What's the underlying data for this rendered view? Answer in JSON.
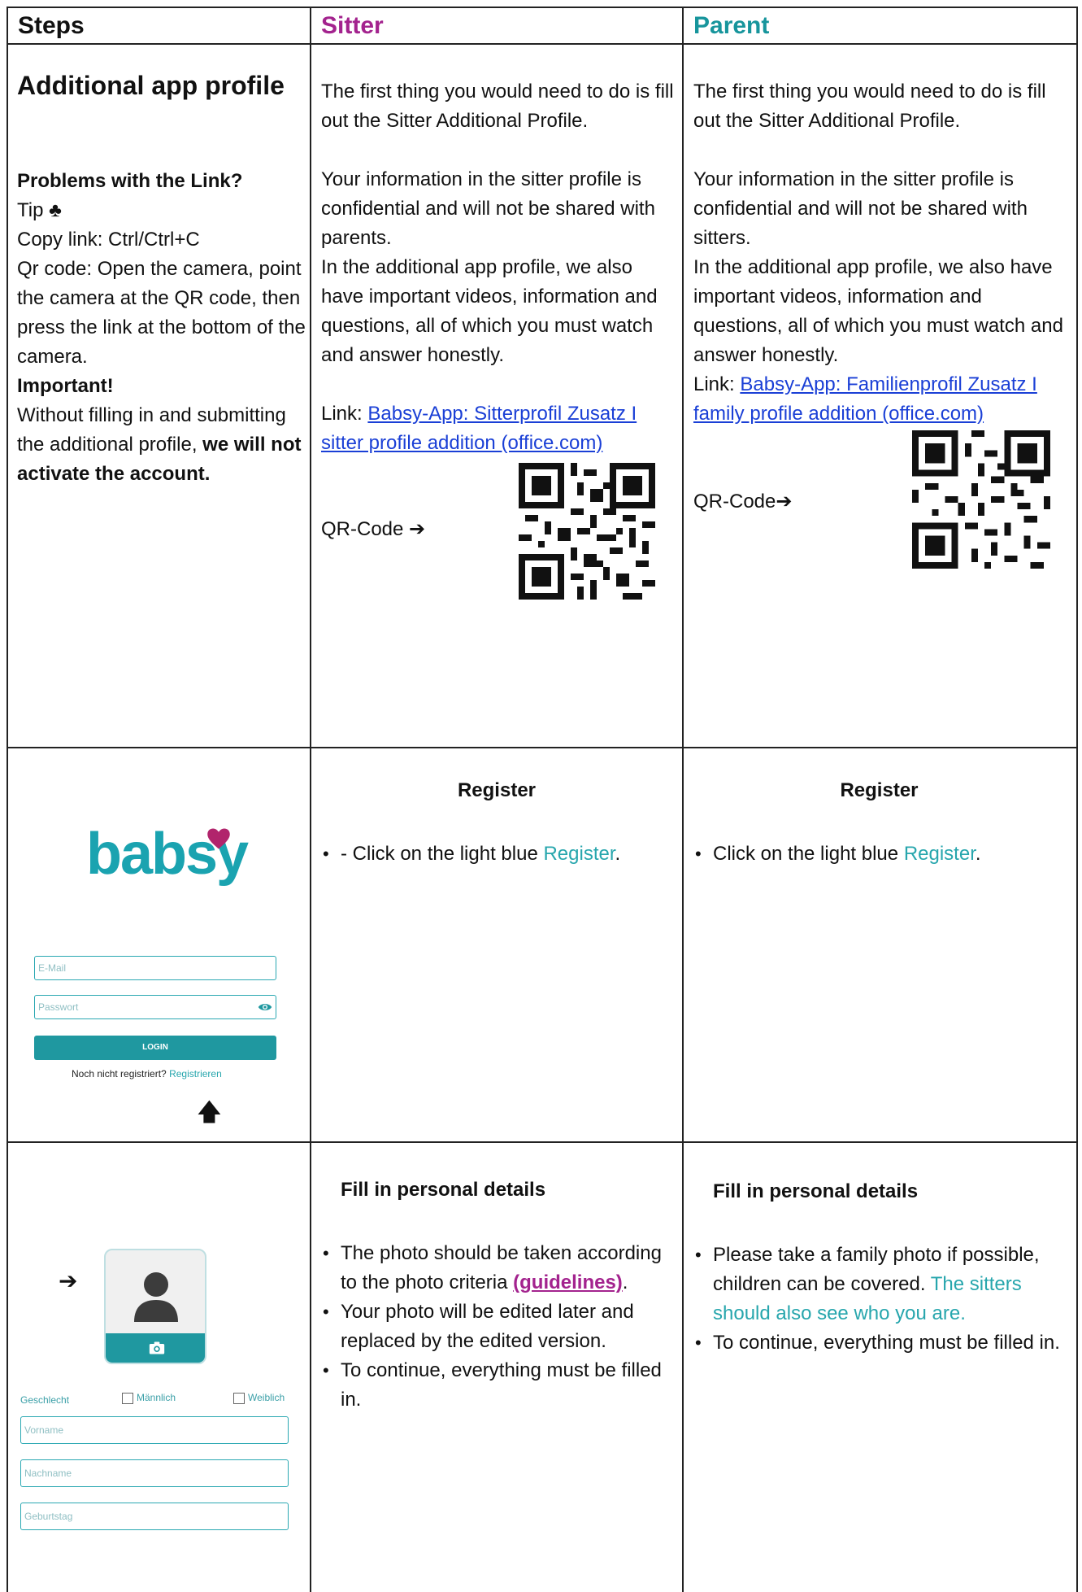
{
  "headers": {
    "steps": "Steps",
    "sitter": "Sitter",
    "parent": "Parent"
  },
  "row1": {
    "steps": {
      "title": "Additional app profile",
      "problems_heading": "Problems with the Link?",
      "tip": "Tip ♣",
      "copy_link": "Copy link: Ctrl/Ctrl+C",
      "qr_instructions": "Qr code: Open the camera, point the camera at the QR code, then press the link at the bottom of the camera.",
      "important_heading": "Important!",
      "important_text_start": "Without filling in and submitting the additional profile,",
      "important_text_bold": "we will not activate the account."
    },
    "sitter": {
      "para1": "The first thing you would need to do is fill out the Sitter Additional Profile.",
      "para2": "Your information in the sitter profile is confidential and will not be shared with parents.",
      "para3": "In the additional app profile, we also have important videos, information and questions, all of which you must watch and answer honestly.",
      "link_prefix": "Link:",
      "link_text": "Babsy-App: Sitterprofil Zusatz I sitter profile addition (office.com)",
      "qr_label": "QR-Code ➔"
    },
    "parent": {
      "para1": "The first thing you would need to do is fill out the Sitter Additional Profile.",
      "para2": "Your information in the sitter profile is confidential and will not be shared with sitters.",
      "para3": "In the additional app profile, we also have important videos, information and questions, all of which you must watch and answer honestly.",
      "link_prefix": "Link:",
      "link_text": "Babsy-App: Familienprofil Zusatz I family profile addition (office.com)",
      "qr_label": "QR-Code➔"
    }
  },
  "row2": {
    "mock": {
      "logo": "babsy",
      "email_placeholder": "E-Mail",
      "password_placeholder": "Passwort",
      "login_button": "LOGIN",
      "not_registered": "Noch nicht registriert?",
      "register_link": "Registrieren",
      "arrow": "🡅"
    },
    "sitter": {
      "title": "Register",
      "bullet_prefix": "- Click on the light blue",
      "bullet_link": "Register",
      "bullet_end": "."
    },
    "parent": {
      "title": "Register",
      "bullet_prefix": "Click on the light blue",
      "bullet_link": "Register",
      "bullet_end": "."
    }
  },
  "row3": {
    "mock": {
      "arrow": "➔",
      "gender_label": "Geschlecht",
      "male": "Männlich",
      "female": "Weiblich",
      "first_name": "Vorname",
      "last_name": "Nachname",
      "birthday": "Geburtstag"
    },
    "sitter": {
      "title": "Fill in personal details",
      "b1_start": "The photo should be taken according to the photo criteria",
      "b1_link": "(guidelines)",
      "b1_end": ".",
      "b2": "Your photo will be edited later and replaced by the edited version.",
      "b3": "To continue, everything must be filled in."
    },
    "parent": {
      "title": "Fill in personal details",
      "b1_start": "Please take a family photo if possible, children can be covered.",
      "b1_teal": "The sitters should also see who you are.",
      "b2": "To continue, everything must be filled in."
    }
  },
  "colors": {
    "sitter": "#a3238e",
    "parent": "#17959c",
    "teal": "#27a6ad",
    "link": "#1a3fd6",
    "app_teal": "#1f98a0"
  }
}
